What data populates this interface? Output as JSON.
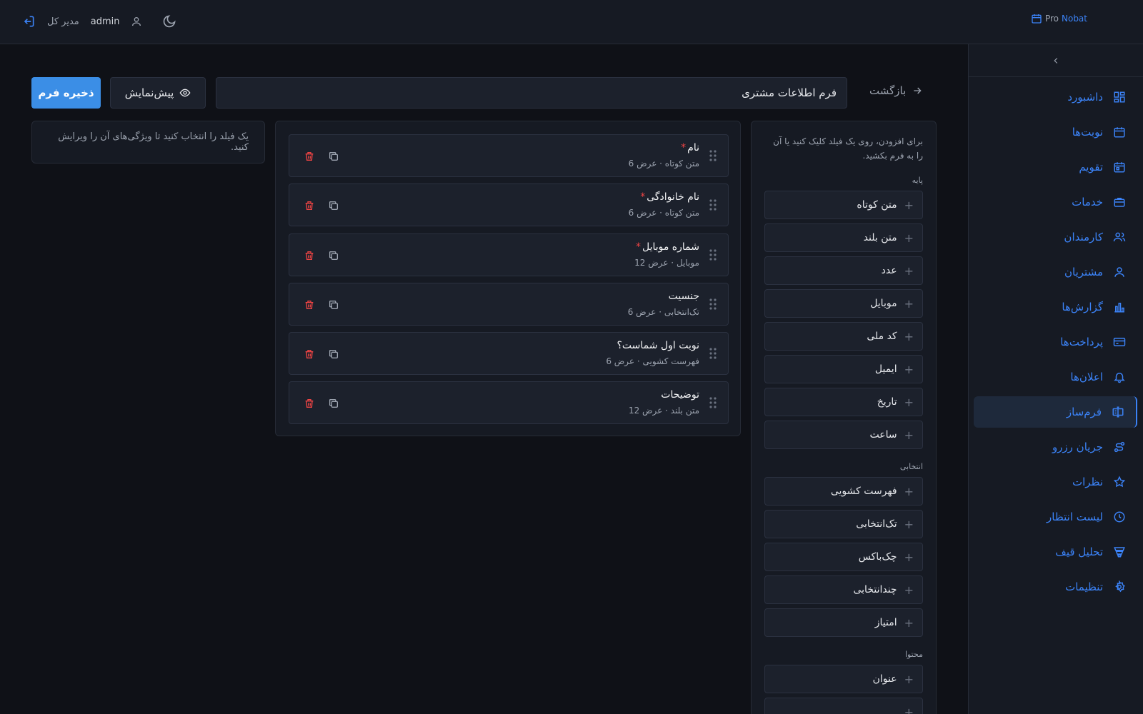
{
  "header": {
    "brand_pro": "Pro",
    "brand_nobat": "Nobat",
    "role": "مدیر کل",
    "username": "admin"
  },
  "sidebar": {
    "items": [
      {
        "label": "داشبورد",
        "icon": "dashboard-icon"
      },
      {
        "label": "نوبت‌ها",
        "icon": "calendar-icon"
      },
      {
        "label": "تقویم",
        "icon": "calendar-day-icon"
      },
      {
        "label": "خدمات",
        "icon": "briefcase-icon"
      },
      {
        "label": "کارمندان",
        "icon": "users-icon"
      },
      {
        "label": "مشتریان",
        "icon": "user-icon"
      },
      {
        "label": "گزارش‌ها",
        "icon": "bar-chart-icon"
      },
      {
        "label": "پرداخت‌ها",
        "icon": "credit-card-icon"
      },
      {
        "label": "اعلان‌ها",
        "icon": "bell-icon"
      },
      {
        "label": "فرم‌ساز",
        "icon": "form-builder-icon",
        "active": true
      },
      {
        "label": "جریان رزرو",
        "icon": "flow-icon"
      },
      {
        "label": "نظرات",
        "icon": "star-icon"
      },
      {
        "label": "لیست انتظار",
        "icon": "clock-icon"
      },
      {
        "label": "تحلیل قیف",
        "icon": "funnel-icon"
      },
      {
        "label": "تنظیمات",
        "icon": "gear-icon"
      }
    ]
  },
  "toolbar": {
    "back_label": "بازگشت",
    "form_title_value": "فرم اطلاعات مشتری",
    "preview_label": "پیش‌نمایش",
    "save_label": "ذخیره فرم"
  },
  "palette": {
    "hint": "برای افزودن، روی یک فیلد کلیک کنید یا آن را به فرم بکشید.",
    "groups": [
      {
        "label": "پایه",
        "items": [
          "متن کوتاه",
          "متن بلند",
          "عدد",
          "موبایل",
          "کد ملی",
          "ایمیل",
          "تاریخ",
          "ساعت"
        ]
      },
      {
        "label": "انتخابی",
        "items": [
          "فهرست کشویی",
          "تک‌انتخابی",
          "چک‌باکس",
          "چندانتخابی",
          "امتیاز"
        ]
      },
      {
        "label": "محتوا",
        "items": [
          "عنوان",
          ""
        ]
      }
    ]
  },
  "fields": [
    {
      "name": "نام",
      "required": true,
      "meta": "متن کوتاه · عرض 6"
    },
    {
      "name": "نام خانوادگی",
      "required": true,
      "meta": "متن کوتاه · عرض 6"
    },
    {
      "name": "شماره موبایل",
      "required": true,
      "meta": "موبایل · عرض 12"
    },
    {
      "name": "جنسیت",
      "required": false,
      "meta": "تک‌انتخابی · عرض 6"
    },
    {
      "name": "نوبت اول شماست؟",
      "required": false,
      "meta": "فهرست کشویی · عرض 6"
    },
    {
      "name": "توضیحات",
      "required": false,
      "meta": "متن بلند · عرض 12"
    }
  ],
  "properties": {
    "empty_hint": "یک فیلد را انتخاب کنید تا ویژگی‌های آن را ویرایش کنید."
  },
  "colors": {
    "accent": "#3b82f6",
    "danger": "#ef4444",
    "save_button": "#3b8ee6"
  }
}
